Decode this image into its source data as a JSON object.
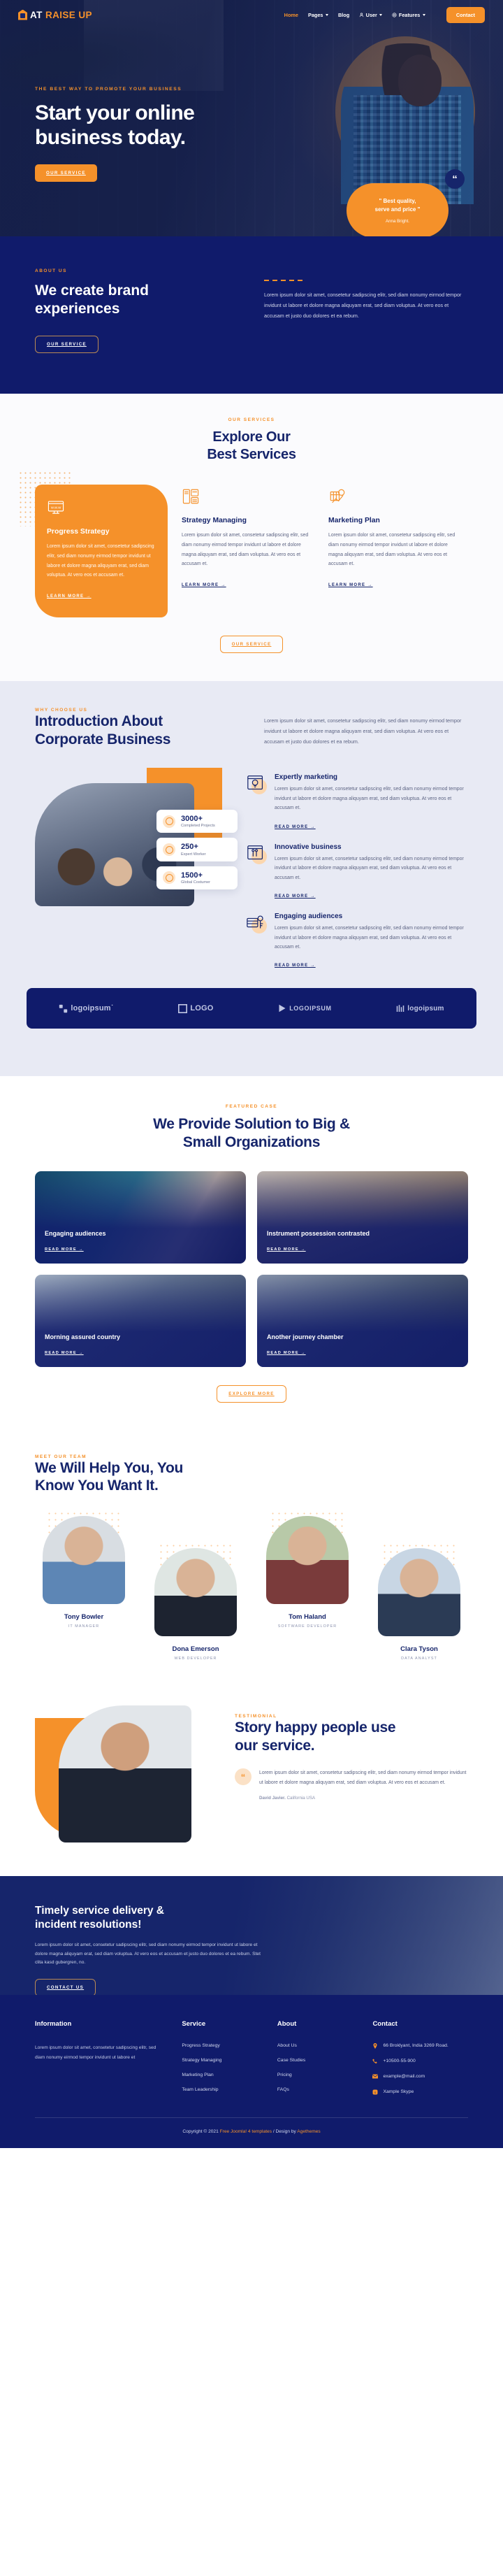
{
  "header": {
    "logo_text_primary": "AT",
    "logo_text_accent": "RAISE UP",
    "nav": [
      {
        "label": "Home",
        "icon": "",
        "caret": false,
        "active": true
      },
      {
        "label": "Pages",
        "icon": "",
        "caret": true,
        "active": false
      },
      {
        "label": "Blog",
        "icon": "",
        "caret": false,
        "active": false
      },
      {
        "label": "User",
        "icon": "user-icon",
        "caret": true,
        "active": false
      },
      {
        "label": "Features",
        "icon": "gear-icon",
        "caret": true,
        "active": false
      }
    ],
    "contact_button": "Contact"
  },
  "hero": {
    "eyebrow": "THE BEST WAY TO PROMOTE YOUR BUSINESS",
    "title_line1": "Start your online",
    "title_line2": "business today.",
    "button": "OUR SERVICE",
    "quote_mark": "“",
    "quote_line1": "\" Best quality,",
    "quote_line2": "serve and price \"",
    "quote_author": "Anna Bright."
  },
  "about": {
    "eyebrow": "ABOUT US",
    "title": "We create brand experiences",
    "button": "OUR SERVICE",
    "paragraph": "Lorem ipsum dolor sit amet, consetetur sadipscing elitr, sed diam nonumy eirmod tempor invidunt ut labore et dolore magna aliquyam erat, sed diam voluptua. At vero eos et accusam et justo duo dolores et ea rebum."
  },
  "services": {
    "eyebrow": "OUR SERVICES",
    "title_line1": "Explore Our",
    "title_line2": "Best Services",
    "bottom_button": "OUR SERVICE",
    "items": [
      {
        "icon": "monitor-www-icon",
        "title": "Progress Strategy",
        "text": "Lorem ipsum dolor sit amet, consetetur sadipscing elitr, sed diam nonumy eirmod tempor invidunt ut labore et dolore magna aliquyam erat, sed diam voluptua. At vero eos et accusam et.",
        "link": "LEARN MORE →"
      },
      {
        "icon": "layout-grid-icon",
        "title": "Strategy Managing",
        "text": "Lorem ipsum dolor sit amet, consetetur sadipscing elitr, sed diam nonumy eirmod tempor invidunt ut labore et dolore magna aliquyam erat, sed diam voluptua. At vero eos et accusam et.",
        "link": "LEARN MORE →"
      },
      {
        "icon": "chart-growth-icon",
        "title": "Marketing Plan",
        "text": "Lorem ipsum dolor sit amet, consetetur sadipscing elitr, sed diam nonumy eirmod tempor invidunt ut labore et dolore magna aliquyam erat, sed diam voluptua. At vero eos et accusam et.",
        "link": "LEARN MORE →"
      }
    ]
  },
  "why": {
    "eyebrow": "WHY CHOOSE US",
    "title_line1": "Introduction About",
    "title_line2": "Corporate Business",
    "paragraph": "Lorem ipsum dolor sit amet, consetetur sadipscing elitr, sed diam nonumy eirmod tempor invidunt ut labore et dolore magna aliquyam erat, sed diam voluptua. At vero eos et accusam et justo duo dolores et ea rebum.",
    "stats": [
      {
        "icon": "trophy-icon",
        "number": "3000+",
        "label": "Completed Projects"
      },
      {
        "icon": "badge-icon",
        "number": "250+",
        "label": "Expert Worker"
      },
      {
        "icon": "globe-icon",
        "number": "1500+",
        "label": "Global Costumer"
      }
    ],
    "features": [
      {
        "icon": "lightbulb-window-icon",
        "title": "Expertly marketing",
        "text": "Lorem ipsum dolor sit amet, consetetur sadipscing elitr, sed diam nonumy eirmod tempor invidunt ut labore et dolore magna aliquyam erat, sed diam voluptua. At vero eos et accusam et.",
        "link": "READ MORE →"
      },
      {
        "icon": "tools-window-icon",
        "title": "Innovative business",
        "text": "Lorem ipsum dolor sit amet, consetetur sadipscing elitr, sed diam nonumy eirmod tempor invidunt ut labore et dolore magna aliquyam erat, sed diam voluptua. At vero eos et accusam et.",
        "link": "READ MORE →"
      },
      {
        "icon": "key-server-icon",
        "title": "Engaging audiences",
        "text": "Lorem ipsum dolor sit amet, consetetur sadipscing elitr, sed diam nonumy eirmod tempor invidunt ut labore et dolore magna aliquyam erat, sed diam voluptua. At vero eos et accusam et.",
        "link": "READ MORE →"
      }
    ]
  },
  "logos": [
    {
      "name": "logoipsum-wordmark"
    },
    {
      "name": "logo-square-circles"
    },
    {
      "name": "logoipsum-play"
    },
    {
      "name": "logoipsum-bars"
    }
  ],
  "logo_labels": [
    "logoipsum˙",
    "LOGO",
    "LOGOIPSUM",
    "logoipsum"
  ],
  "cases": {
    "eyebrow": "FEATURED CASE",
    "title_line1": "We Provide Solution to Big &",
    "title_line2": "Small Organizations",
    "bottom_button": "EXPLORE MORE",
    "items": [
      {
        "title": "Engaging audiences",
        "link": "READ MORE →"
      },
      {
        "title": "Instrument possession contrasted",
        "link": "READ MORE →"
      },
      {
        "title": "Morning assured country",
        "link": "READ MORE →"
      },
      {
        "title": "Another journey chamber",
        "link": "READ MORE →"
      }
    ]
  },
  "team": {
    "eyebrow": "MEET OUR TEAM",
    "title_line1": "We Will Help You, You",
    "title_line2": "Know You Want It.",
    "members": [
      {
        "name": "Tony Bowler",
        "role": "IT MANAGER"
      },
      {
        "name": "Dona Emerson",
        "role": "WEB DEVELOPER"
      },
      {
        "name": "Tom Haland",
        "role": "SOFTWARE DEVELOPER"
      },
      {
        "name": "Clara Tyson",
        "role": "DATA ANALYST"
      }
    ]
  },
  "testimonial": {
    "eyebrow": "TESTIMONIAL",
    "title_line1": "Story happy people use",
    "title_line2": "our service.",
    "quote_mark": "“",
    "text": "Lorem ipsum dolor sit amet, consetetur sadipscing elitr, sed diam nonumy eirmod tempor invidunt ut labore et dolore magna aliquyam erat, sed diam voluptua. At vero eos et accusam et.",
    "author": "David Javier.",
    "author_location": " California USA"
  },
  "cta": {
    "title_line1": "Timely service delivery &",
    "title_line2": "incident resolutions!",
    "paragraph": "Lorem ipsum dolor sit amet, consetetur sadipscing elitr, sed diam nonumy eirmod tempor invidunt ut labore et dolore magna aliquyam erat, sed diam voluptua. At vero eos et accusam et justo duo dolores et ea rebum. Stet clita kasd gubergren, no.",
    "button": "CONTACT US"
  },
  "footer": {
    "information": {
      "title": "Information",
      "text": "Lorem ipsum dolor sit amet, consetetur sadipscing elitr, sed diam nonumy eirmod tempor invidunt ut labore et"
    },
    "service": {
      "title": "Service",
      "items": [
        "Progress Strategy",
        "Strategy Managing",
        "Marketing Plan",
        "Team Leadership"
      ]
    },
    "about": {
      "title": "About",
      "items": [
        "About Us",
        "Case Studies",
        "Pricing",
        "FAQs"
      ]
    },
    "contact": {
      "title": "Contact",
      "items": [
        {
          "icon": "map-pin-icon",
          "text": "66 Broklyant, India 3269 Road."
        },
        {
          "icon": "phone-icon",
          "text": "+10500-55-900"
        },
        {
          "icon": "mail-icon",
          "text": "example@mail.com"
        },
        {
          "icon": "skype-icon",
          "text": "Xample Skype"
        }
      ]
    },
    "copyright_prefix": "Copyright © 2021 ",
    "copyright_link1": "Free Joomla! 4 templates",
    "copyright_mid": " / Design by ",
    "copyright_link2": "Agethemes"
  },
  "colors": {
    "brand_blue": "#101b6b",
    "accent_orange": "#f5912a",
    "dark_navy": "#16256b",
    "light_grey": "#e8eaf4"
  }
}
